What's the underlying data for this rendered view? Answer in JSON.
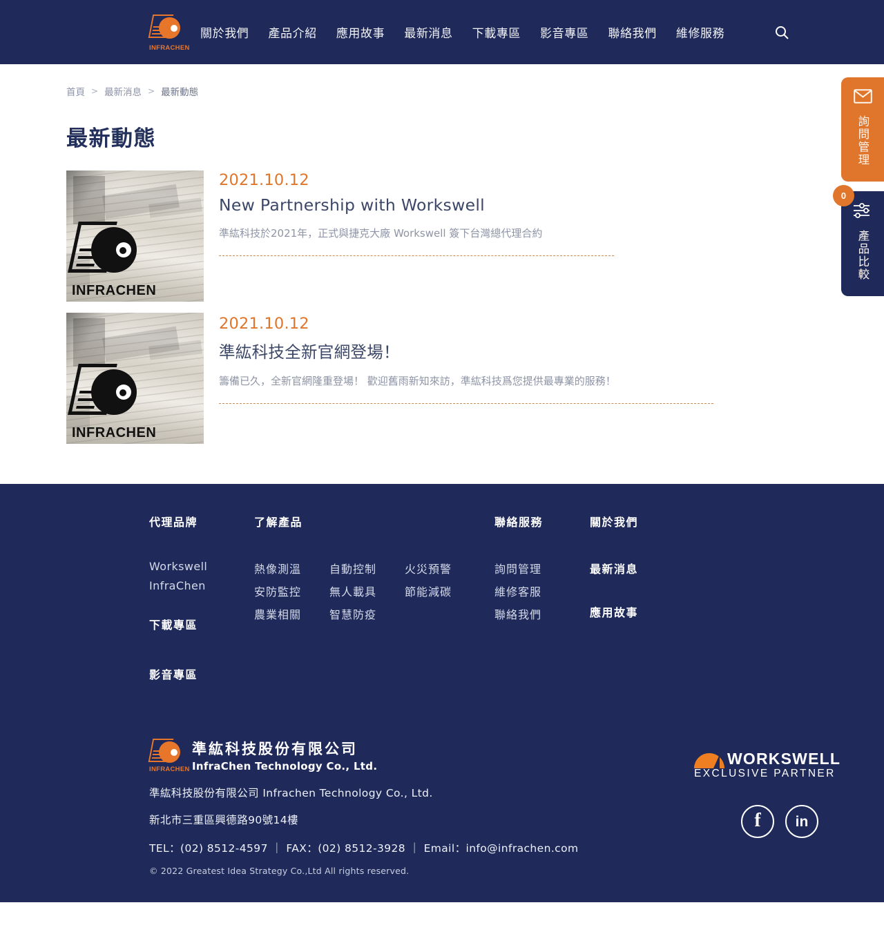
{
  "brand": {
    "logo_word": "INFRACHEN",
    "accent_orange": "#e0762b",
    "navy": "#1f2a5a"
  },
  "header": {
    "nav_items": [
      {
        "label": "關於我們"
      },
      {
        "label": "產品介紹"
      },
      {
        "label": "應用故事"
      },
      {
        "label": "最新消息"
      },
      {
        "label": "下載專區"
      },
      {
        "label": "影音專區"
      },
      {
        "label": "聯絡我們"
      },
      {
        "label": "維修服務"
      }
    ],
    "search_icon": "search-icon"
  },
  "breadcrumb": {
    "items": [
      {
        "label": "首頁"
      },
      {
        "label": "最新消息"
      },
      {
        "label": "最新動態"
      }
    ],
    "separator": ">"
  },
  "page": {
    "title": "最新動態"
  },
  "news": [
    {
      "date": "2021.10.12",
      "title": "New Partnership with Workswell",
      "desc": "準紘科技於2021年，正式與捷克大廠 Workswell 簽下台灣總代理合約",
      "thumb_watermark": "INFRACHEN"
    },
    {
      "date": "2021.10.12",
      "title": "準紘科技全新官網登場！",
      "desc": "籌備已久，全新官網隆重登場！ 歡迎舊雨新知來訪，準紘科技爲您提供最專業的服務！",
      "thumb_watermark": "INFRACHEN"
    }
  ],
  "side_widgets": {
    "inquiry": {
      "label": "詢問管理",
      "icon": "mail-icon"
    },
    "compare": {
      "label": "產品比較",
      "icon": "sliders-icon",
      "badge_count": "0"
    }
  },
  "footer": {
    "columns": {
      "brands": {
        "heading": "代理品牌",
        "links": [
          "Workswell",
          "InfraChen"
        ],
        "extra_headings": [
          "下載專區",
          "影音專區"
        ]
      },
      "products": {
        "heading": "了解產品",
        "col1": [
          "熱像測溫",
          "安防監控",
          "農業相關"
        ],
        "col2": [
          "自動控制",
          "無人載具",
          "智慧防疫"
        ],
        "col3": [
          "火災預警",
          "節能減碳"
        ]
      },
      "service": {
        "heading": "聯絡服務",
        "links": [
          "詢問管理",
          "維修客服",
          "聯絡我們"
        ]
      },
      "about": {
        "heading": "關於我們",
        "heading2": "最新消息",
        "heading3": "應用故事"
      }
    },
    "company": {
      "logo_cn": "準紘科技股份有限公司",
      "logo_en": "InfraChen Technology Co., Ltd.",
      "name_line": "準紘科技股份有限公司 Infrachen Technology Co., Ltd.",
      "address": "新北市三重區興德路90號14樓",
      "contact": "TEL：(02) 8512-4597 ｜ FAX：(02) 8512-3928 ｜ Email：info@infrachen.com",
      "copyright": "© 2022 Greatest Idea Strategy Co.,Ltd All rights reserved."
    },
    "partner": {
      "word": "WORKSWELL",
      "subtitle": "EXCLUSIVE PARTNER"
    },
    "socials": [
      {
        "name": "facebook-icon",
        "glyph": "f"
      },
      {
        "name": "linkedin-icon",
        "glyph": "in"
      }
    ]
  }
}
